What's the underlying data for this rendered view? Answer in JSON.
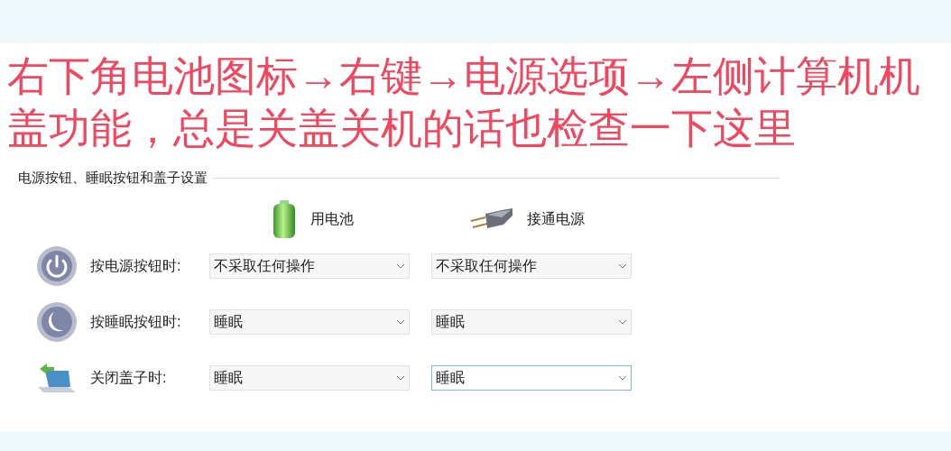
{
  "caption": {
    "lines": [
      "右下角电池图标→右键→电源选项→左侧计算机机",
      "盖功能，总是关盖关机的话也检查一下这里"
    ]
  },
  "section_title": "电源按钮、睡眠按钮和盖子设置",
  "columns": [
    {
      "kind": "battery",
      "label": "用电池"
    },
    {
      "kind": "plug",
      "label": "接通电源"
    }
  ],
  "rows": [
    {
      "kind": "power",
      "label": "按电源按钮时:",
      "selects": [
        {
          "value": "不采取任何操作",
          "focused": false
        },
        {
          "value": "不采取任何操作",
          "focused": false
        }
      ]
    },
    {
      "kind": "sleep",
      "label": "按睡眠按钮时:",
      "selects": [
        {
          "value": "睡眠",
          "focused": false
        },
        {
          "value": "睡眠",
          "focused": false
        }
      ]
    },
    {
      "kind": "lid",
      "label": "关闭盖子时:",
      "selects": [
        {
          "value": "睡眠",
          "focused": false
        },
        {
          "value": "睡眠",
          "focused": true
        }
      ]
    }
  ]
}
